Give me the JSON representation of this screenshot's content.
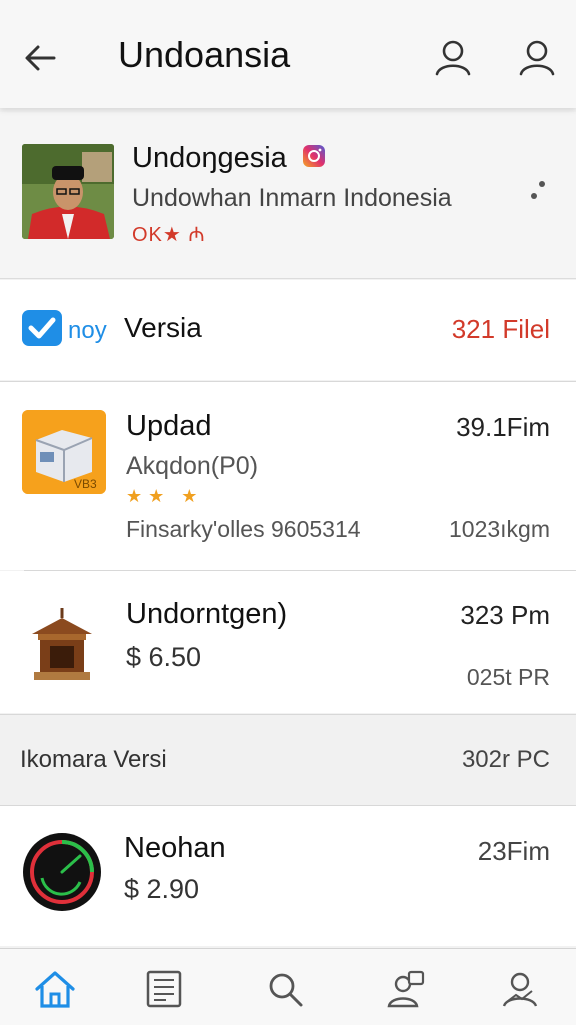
{
  "header": {
    "title": "Undoansia",
    "back_icon": "arrow-left-icon",
    "actions": [
      "person-icon",
      "person-icon"
    ]
  },
  "profile": {
    "name": "Undoŋgesia",
    "subtitle": "Undowhan Inmarn Indonesia",
    "rating_text": "OK★ ₼",
    "badge_icon": "instagram-icon",
    "more_icon": "more-dots-icon"
  },
  "version_row": {
    "logo_text": "noy",
    "label": "Versia",
    "meta": "321 Filel"
  },
  "update_item": {
    "title": "Updad",
    "subtitle": "Akqdon(P0)",
    "stars": "★★ ★",
    "footer": "Finsarky'olles 9605314",
    "time": "39.1Fim",
    "size": "1023ıkgm",
    "icon_badge": "VB3"
  },
  "gen_item": {
    "title": "Undorntgen)",
    "price": "$ 6.50",
    "time": "323 Pm",
    "meta": "025t PR"
  },
  "section": {
    "label": "Ikomara Versi",
    "meta": "302r PC"
  },
  "neohan_item": {
    "title": "Neohan",
    "price": "$ 2.90",
    "time": "23Fim"
  },
  "bottom_nav": [
    "home-icon",
    "news-icon",
    "search-icon",
    "contacts-icon",
    "profile-icon"
  ],
  "colors": {
    "accent": "#1f8ee6",
    "price_red": "#d23a2a",
    "icon_orange": "#f6a11c"
  }
}
